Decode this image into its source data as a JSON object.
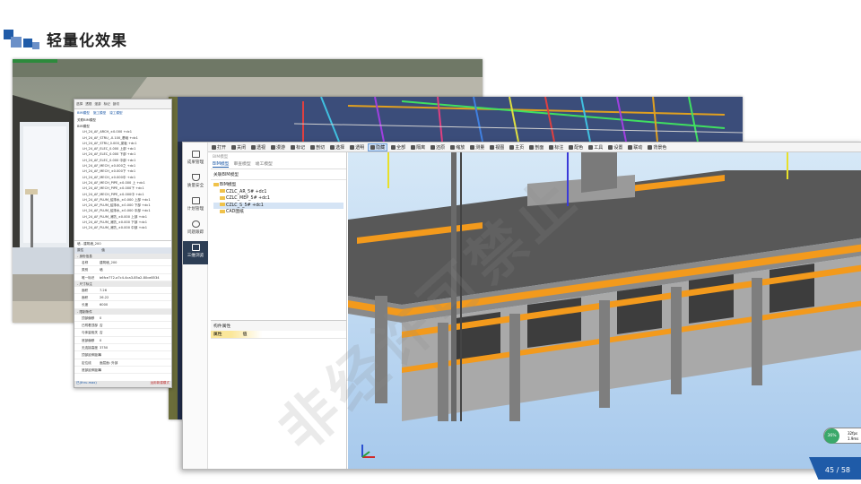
{
  "slide": {
    "title": "轻量化效果",
    "watermark": "非经许可禁止",
    "page_number": "45 / 58"
  },
  "secondary_window": {
    "toolbar": [
      "选择",
      "透视",
      "漫游",
      "标记",
      "剖切"
    ],
    "tabs": [
      "BIM模型",
      "施工模型",
      "竣工模型"
    ],
    "tree_title": "关联BIM模型",
    "tree_items": [
      "BIM模型",
      "LH_24_AF_ARCH_±0.000 +dc1",
      "LH_24_AF_STRU_-0.100_基础 +dc1",
      "LH_24_AF_STRU_0.000_梁板 +dc1",
      "LH_24_AF_ELEC_0.000 上部 +dc1",
      "LH_24_AF_ELEC_0.000 下部 +dc1",
      "LH_24_AF_ELEC_0.000 中部 +dc1",
      "LH_24_AF_MECH_±0.000之 +dc1",
      "LH_24_AF_MECH_±0.000下 +dc1",
      "LH_24_AF_MECH_±0.000中 +dc1",
      "LH_24_AF_MECH_PIPE_±0.000 上 +dc1",
      "LH_24_AF_MECH_PIPE_±0.000下 +dc1",
      "LH_24_AF_MECH_PIPE_±0.000中 +dc1",
      "LH_24_AF_PLUM_给排水_±0.000 上部 +dc1",
      "LH_24_AF_PLUM_给排水_±0.000 下部 +dc1",
      "LH_24_AF_PLUM_给排水_±0.000 中部 +dc1",
      "LH_24_AF_PLUM_消防_±0.000 上部 +dc1",
      "LH_24_AF_PLUM_消防_±0.000 下部 +dc1",
      "LH_24_AF_PLUM_消防_±0.000 中部 +dc1"
    ],
    "element_title": "墙 - 建筑墙_200",
    "prop_header": [
      "属性",
      "值"
    ],
    "sections": {
      "identity": "- 身份信息",
      "dimensions": "- 尺寸标注",
      "constraints": "- 限制条件"
    },
    "identity_rows": [
      {
        "k": "名称",
        "v": "建筑墙_200"
      },
      {
        "k": "类别",
        "v": "墙"
      },
      {
        "k": "唯一标识",
        "v": "b6fce772-a7c4-4ca3-85a2-80ce8534"
      }
    ],
    "dimension_rows": [
      {
        "k": "面积",
        "v": "7.26"
      },
      {
        "k": "面积",
        "v": "26.22"
      },
      {
        "k": "长度",
        "v": "6000"
      }
    ],
    "constraint_rows": [
      {
        "k": "顶部偏移",
        "v": "0"
      },
      {
        "k": "已附着顶部",
        "v": "否"
      },
      {
        "k": "与体量相关",
        "v": "否"
      },
      {
        "k": "底部偏移",
        "v": "0"
      },
      {
        "k": "无连接高度",
        "v": "3750"
      },
      {
        "k": "顶部延伸距离",
        "v": "0"
      },
      {
        "k": "定位线",
        "v": "面层面: 外部"
      },
      {
        "k": "底部延伸距离",
        "v": "0"
      }
    ],
    "status_left": "已(thru.max)",
    "status_right": "运用新建模式"
  },
  "main_window": {
    "side_nav": [
      {
        "label": "成果管理",
        "icon": "archive-icon"
      },
      {
        "label": "质量安全",
        "icon": "shield-icon"
      },
      {
        "label": "计划管理",
        "icon": "calendar-icon"
      },
      {
        "label": "问题跟踪",
        "icon": "target-icon"
      },
      {
        "label": "三维浏览",
        "icon": "cube-icon",
        "active": true
      }
    ],
    "toolbar": [
      {
        "label": "打开",
        "icon": "folder-icon"
      },
      {
        "label": "关闭",
        "icon": "close-icon"
      },
      {
        "label": "透视",
        "icon": "perspective-icon"
      },
      {
        "label": "漫游",
        "icon": "eye-icon"
      },
      {
        "label": "标记",
        "icon": "pin-icon"
      },
      {
        "label": "剖切",
        "icon": "section-icon"
      },
      {
        "label": "选择",
        "icon": "cursor-icon"
      },
      {
        "label": "透明",
        "icon": "transparent-icon"
      },
      {
        "label": "隐藏",
        "icon": "hide-icon",
        "active": true
      },
      {
        "label": "全部",
        "icon": "all-icon"
      },
      {
        "label": "隔离",
        "icon": "isolate-icon"
      },
      {
        "label": "还原",
        "icon": "restore-icon"
      },
      {
        "label": "缩放",
        "icon": "zoom-icon"
      },
      {
        "label": "测量",
        "icon": "measure-icon"
      },
      {
        "label": "视图",
        "icon": "view-icon"
      },
      {
        "label": "主页",
        "icon": "home-icon"
      },
      {
        "label": "剖面",
        "icon": "plane-icon"
      },
      {
        "label": "标注",
        "icon": "annotate-icon"
      },
      {
        "label": "配色",
        "icon": "color-icon"
      },
      {
        "label": "工具",
        "icon": "tool-icon"
      },
      {
        "label": "设置",
        "icon": "gear-icon"
      },
      {
        "label": "联动",
        "icon": "link-icon"
      },
      {
        "label": "背景色",
        "icon": "background-icon"
      }
    ],
    "panel_head": "BIM模型",
    "tabs": [
      "BIM模型",
      "审查模型",
      "竣工模型"
    ],
    "filter_label": "关联BIM模型",
    "tree": [
      {
        "label": "BIM模型",
        "level": 0
      },
      {
        "label": "CZLC_AR_5# +dc1",
        "level": 1
      },
      {
        "label": "CZLC_MEP_5# +dc1",
        "level": 1
      },
      {
        "label": "CZLC_S_5# +dc1",
        "level": 1,
        "selected": true
      },
      {
        "label": "CAD图纸",
        "level": 1
      }
    ],
    "props_title": "构件属性",
    "props_header": [
      "属性",
      "值"
    ],
    "zoom_readout": {
      "percent": "36%",
      "a": "32fps",
      "b": "1.9ms"
    }
  },
  "colors": {
    "accent": "#1f5ba8",
    "nav_active": "#2d3e55",
    "orange": "#f39a1c",
    "sky": "#cfe3f5"
  }
}
